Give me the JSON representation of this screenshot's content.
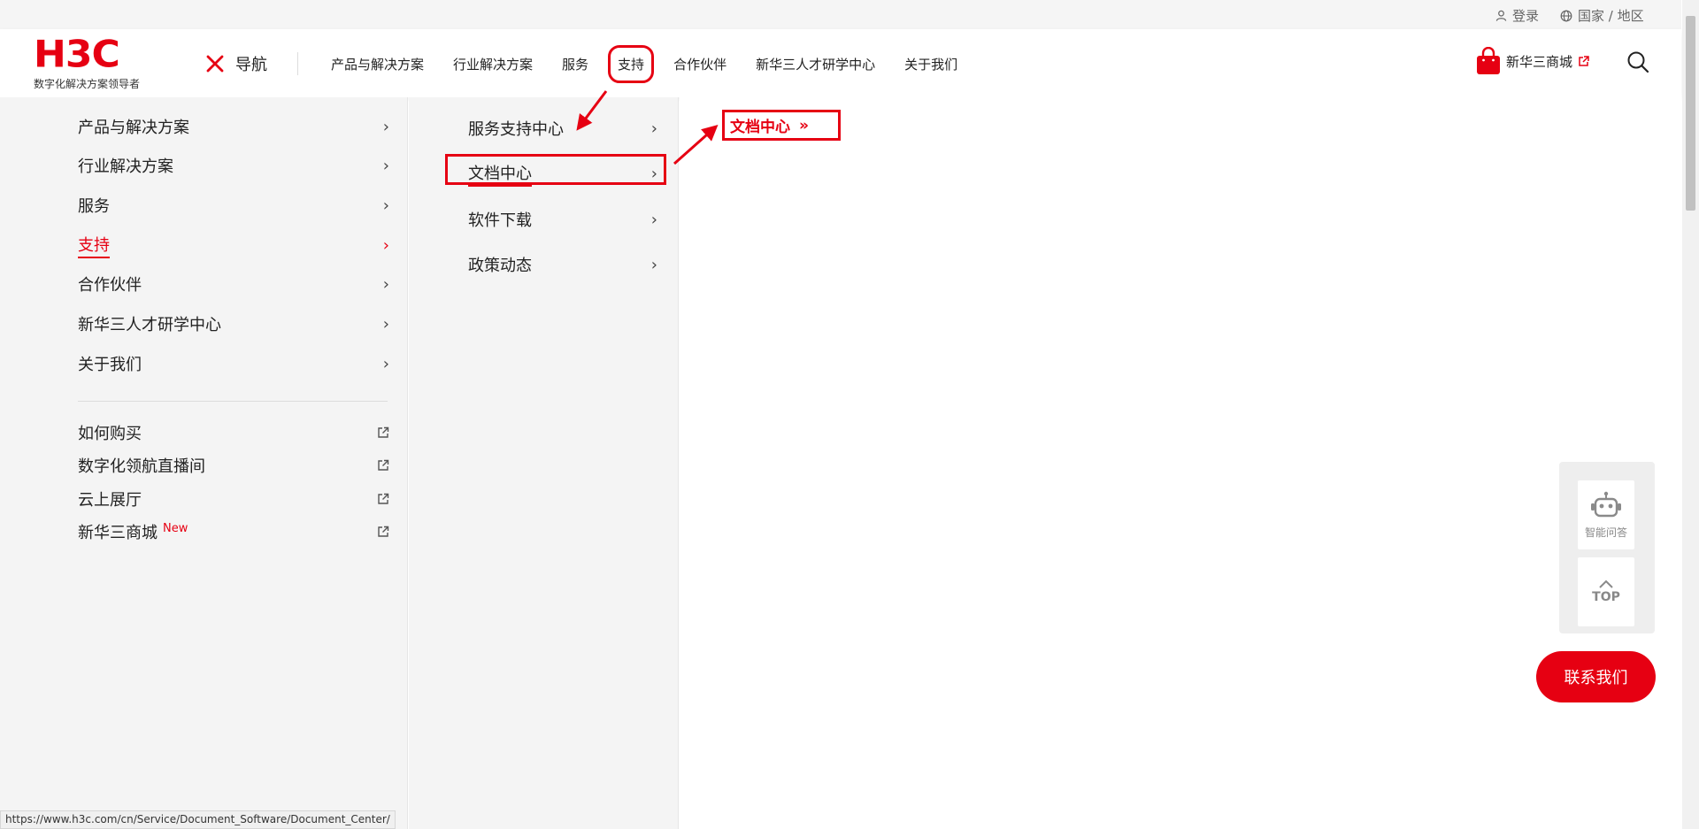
{
  "topbar": {
    "login_label": "登录",
    "region_label": "国家 / 地区"
  },
  "header": {
    "logo_text": "H3C",
    "logo_slogan": "数字化解决方案领导者",
    "nav_toggle_label": "导航",
    "menu": [
      "产品与解决方案",
      "行业解决方案",
      "服务",
      "支持",
      "合作伙伴",
      "新华三人才研学中心",
      "关于我们"
    ],
    "shop_label": "新华三商城"
  },
  "left_nav": {
    "items": [
      "产品与解决方案",
      "行业解决方案",
      "服务",
      "支持",
      "合作伙伴",
      "新华三人才研学中心",
      "关于我们"
    ],
    "active_item": "支持",
    "links": [
      "如何购买",
      "数字化领航直播间",
      "云上展厅",
      "新华三商城"
    ],
    "new_tag": "New"
  },
  "mid_nav": {
    "items": [
      "服务支持中心",
      "文档中心",
      "软件下载",
      "政策动态"
    ],
    "active_item": "文档中心"
  },
  "right_panel": {
    "doc_center_link": "文档中心",
    "doc_center_chevron": "»"
  },
  "float": {
    "assistant_label": "智能问答",
    "top_label": "TOP"
  },
  "contact_label": "联系我们",
  "status_url": "https://www.h3c.com/cn/Service/Document_Software/Document_Center/",
  "colors": {
    "brand_red": "#e60012",
    "panel_bg": "#f4f4f4"
  },
  "icons": [
    "user-icon",
    "globe-icon",
    "close-icon",
    "shopping-bag-icon",
    "external-link-icon",
    "search-icon",
    "chevron-right-icon",
    "robot-icon",
    "arrow-up-icon"
  ]
}
